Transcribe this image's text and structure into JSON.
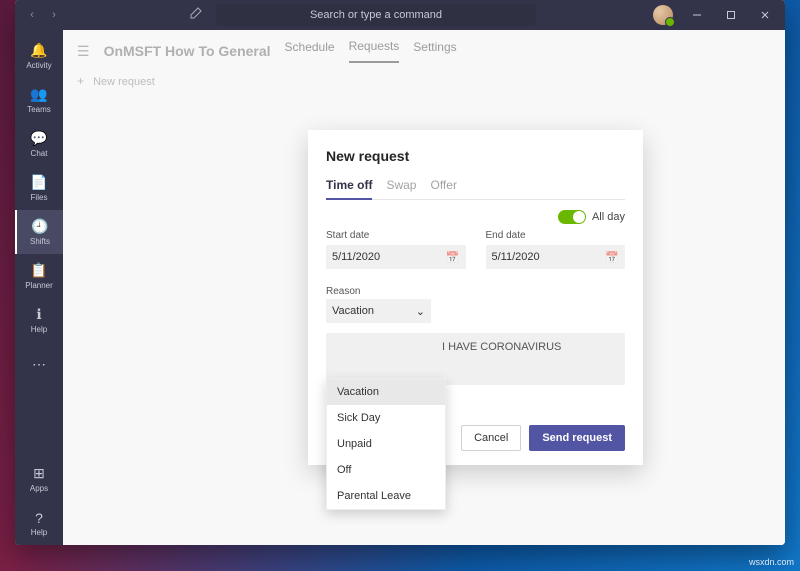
{
  "titlebar": {
    "search_placeholder": "Search or type a command"
  },
  "rail": {
    "items": [
      {
        "label": "Activity"
      },
      {
        "label": "Teams"
      },
      {
        "label": "Chat"
      },
      {
        "label": "Files"
      },
      {
        "label": "Shifts"
      },
      {
        "label": "Planner"
      },
      {
        "label": "Help"
      }
    ],
    "bottom": [
      {
        "label": "Apps"
      },
      {
        "label": "Help"
      }
    ]
  },
  "header": {
    "team_title": "OnMSFT How To General",
    "tabs": {
      "schedule": "Schedule",
      "requests": "Requests",
      "settings": "Settings"
    },
    "new_request": "New request"
  },
  "dialog": {
    "title": "New request",
    "tabs": {
      "time_off": "Time off",
      "swap": "Swap",
      "offer": "Offer"
    },
    "all_day_label": "All day",
    "start_date": {
      "label": "Start date",
      "value": "5/11/2020"
    },
    "end_date": {
      "label": "End date",
      "value": "5/11/2020"
    },
    "reason": {
      "label": "Reason",
      "selected": "Vacation",
      "options": [
        "Vacation",
        "Sick Day",
        "Unpaid",
        "Off",
        "Parental Leave"
      ]
    },
    "note": "I HAVE CORONAVIRUS",
    "cancel": "Cancel",
    "send": "Send request"
  },
  "watermark": "wsxdn.com"
}
